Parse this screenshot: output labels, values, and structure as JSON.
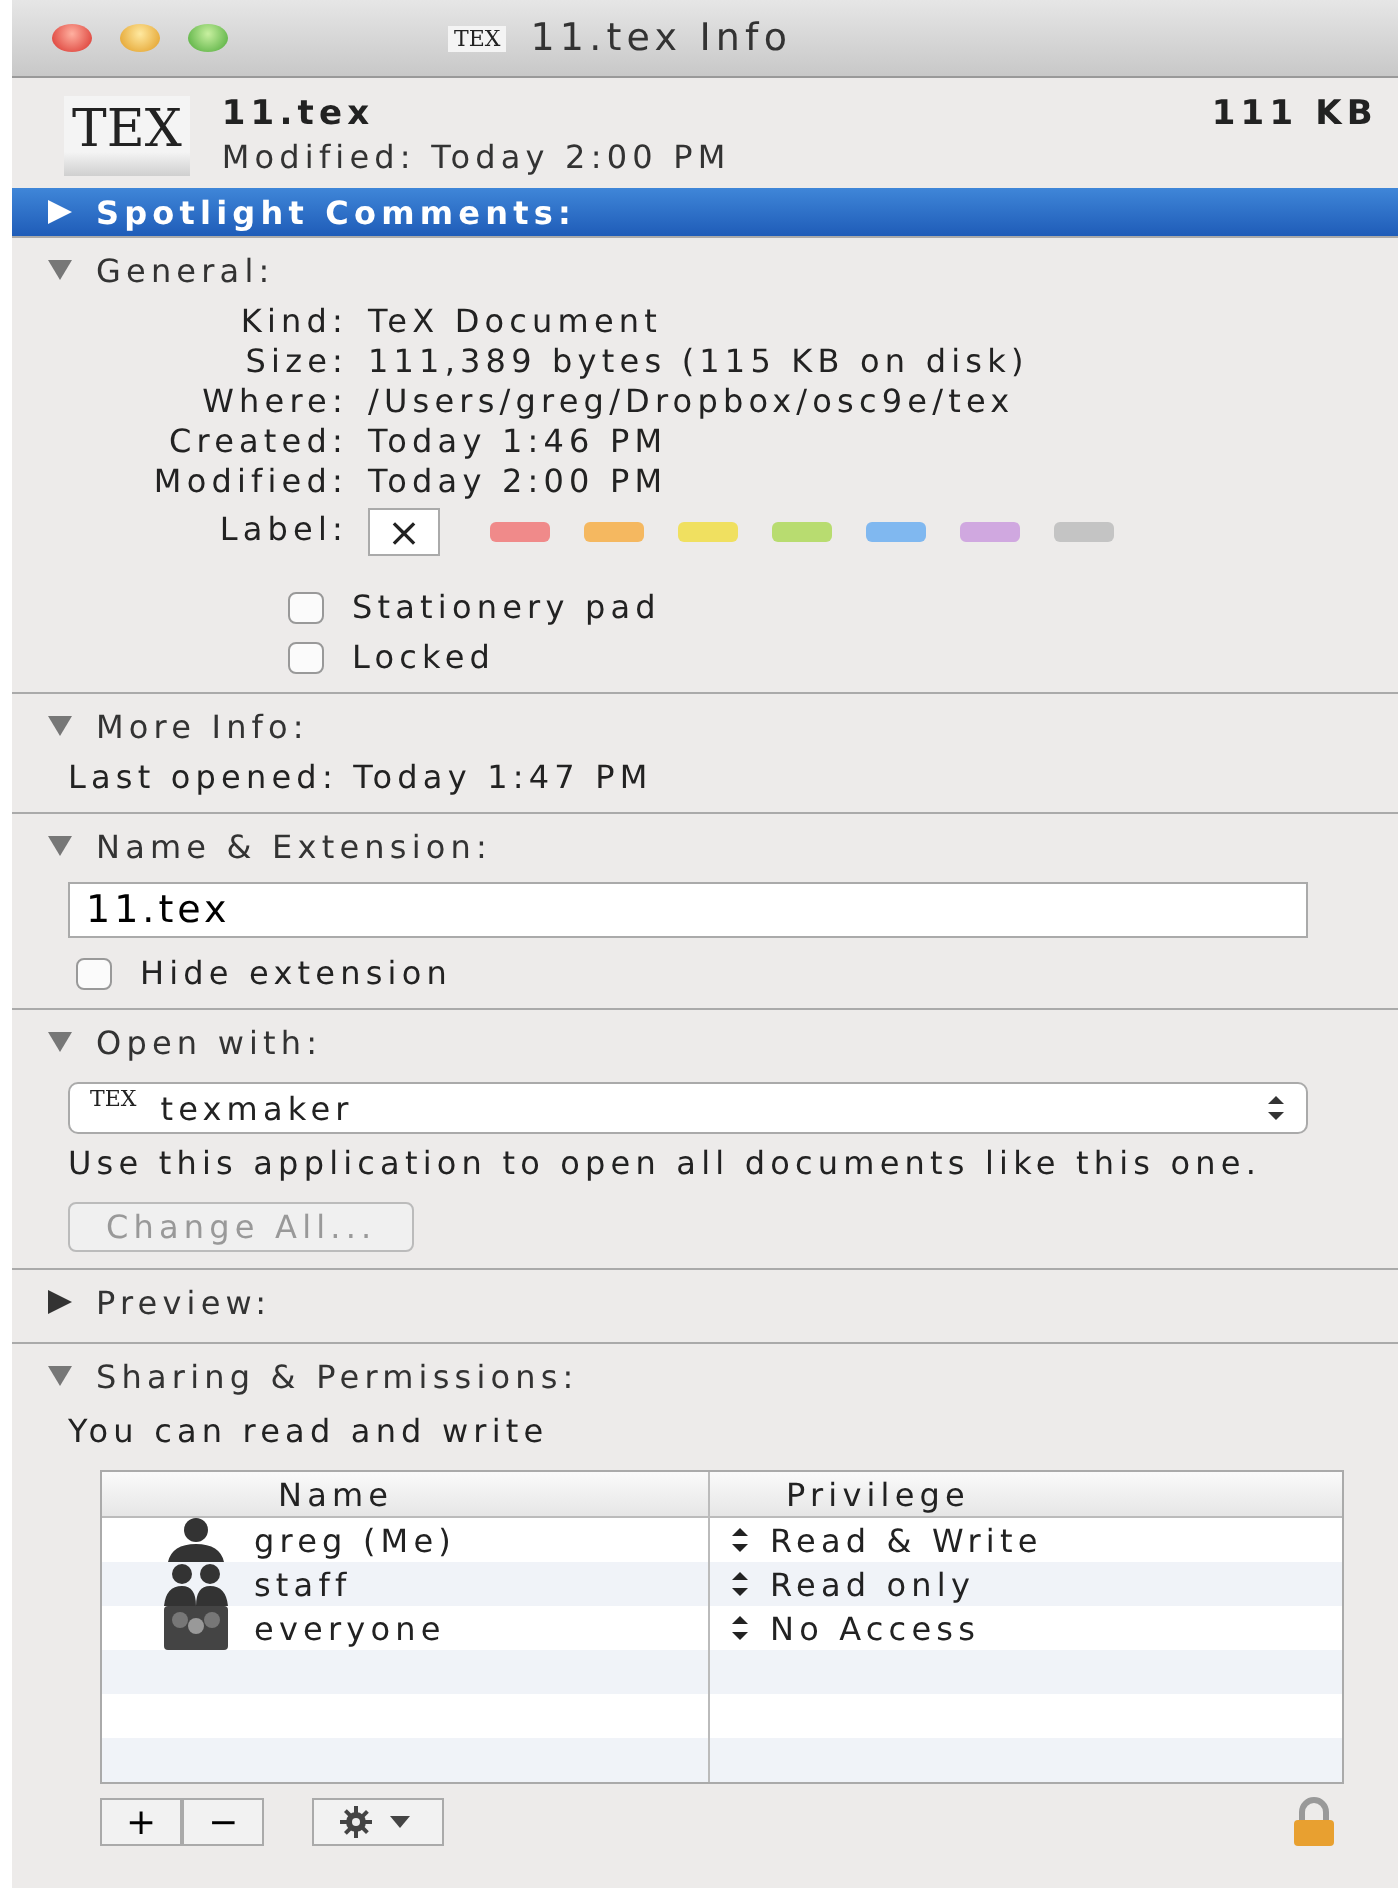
{
  "window": {
    "title": "11.tex Info",
    "title_icon_text": "TEX"
  },
  "header": {
    "icon_text": "TEX",
    "name": "11.tex",
    "size": "111 KB",
    "modified": "Modified: Today 2:00 PM"
  },
  "spotlight": {
    "title": "Spotlight Comments:",
    "expanded": false,
    "selected": true
  },
  "general": {
    "title": "General:",
    "expanded": true,
    "fields": [
      {
        "label": "Kind:",
        "value": "TeX Document"
      },
      {
        "label": "Size:",
        "value": "111,389 bytes (115 KB on disk)"
      },
      {
        "label": "Where:",
        "value": "/Users/greg/Dropbox/osc9e/tex"
      },
      {
        "label": "Created:",
        "value": "Today 1:46 PM"
      },
      {
        "label": "Modified:",
        "value": "Today 2:00 PM"
      }
    ],
    "label_title": "Label:",
    "label_none": "×",
    "label_colors": [
      {
        "color": "#f08a8a"
      },
      {
        "color": "#f5b860"
      },
      {
        "color": "#f0e060"
      },
      {
        "color": "#b8dc70"
      },
      {
        "color": "#80b8f0"
      },
      {
        "color": "#d0a8e0"
      },
      {
        "color": "#c4c4c4"
      }
    ],
    "checkboxes": [
      {
        "label": "Stationery pad",
        "checked": false
      },
      {
        "label": "Locked",
        "checked": false
      }
    ]
  },
  "more_info": {
    "title": "More Info:",
    "expanded": true,
    "last_opened": "Last opened: Today 1:47 PM"
  },
  "name_extension": {
    "title": "Name & Extension:",
    "expanded": true,
    "value": "11.tex",
    "hide_extension": {
      "label": "Hide extension",
      "checked": false
    }
  },
  "open_with": {
    "title": "Open with:",
    "expanded": true,
    "app_icon_text": "TEX",
    "app": "texmaker",
    "note": "Use this application to open all documents like this one.",
    "button": {
      "label": "Change All...",
      "disabled": true
    }
  },
  "preview": {
    "title": "Preview:",
    "expanded": false
  },
  "sharing": {
    "title": "Sharing & Permissions:",
    "expanded": true,
    "summary": "You can read and write",
    "columns": [
      "Name",
      "Privilege"
    ],
    "rows": [
      {
        "kind": "user",
        "name": "greg (Me)",
        "privilege": "Read & Write"
      },
      {
        "kind": "group",
        "name": "staff",
        "privilege": "Read only"
      },
      {
        "kind": "everyone",
        "name": "everyone",
        "privilege": "No Access"
      }
    ],
    "add": "+",
    "remove": "−"
  }
}
